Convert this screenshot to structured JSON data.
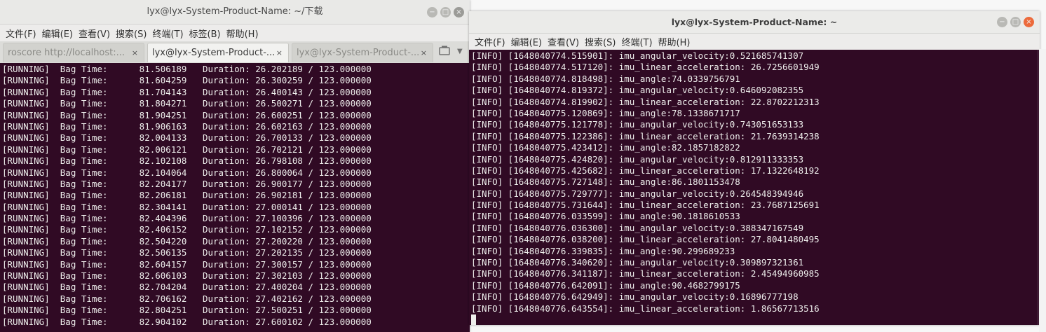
{
  "left_window": {
    "title": "lyx@lyx-System-Product-Name: ~/下载",
    "menu": [
      "文件(F)",
      "编辑(E)",
      "查看(V)",
      "搜索(S)",
      "终端(T)",
      "标签(B)",
      "帮助(H)"
    ],
    "tabs": [
      {
        "label": "roscore http://localhost:...",
        "close": "×"
      },
      {
        "label": "lyx@lyx-System-Product-...",
        "close": "×"
      },
      {
        "label": "lyx@lyx-System-Product-...",
        "close": "×"
      }
    ],
    "window_buttons": {
      "minimize": "−",
      "maximize": "□",
      "close": "×"
    },
    "lines": [
      "[RUNNING]  Bag Time:      81.506189   Duration: 26.202189 / 123.000000",
      "[RUNNING]  Bag Time:      81.604259   Duration: 26.300259 / 123.000000",
      "[RUNNING]  Bag Time:      81.704143   Duration: 26.400143 / 123.000000",
      "[RUNNING]  Bag Time:      81.804271   Duration: 26.500271 / 123.000000",
      "[RUNNING]  Bag Time:      81.904251   Duration: 26.600251 / 123.000000",
      "[RUNNING]  Bag Time:      81.906163   Duration: 26.602163 / 123.000000",
      "[RUNNING]  Bag Time:      82.004133   Duration: 26.700133 / 123.000000",
      "[RUNNING]  Bag Time:      82.006121   Duration: 26.702121 / 123.000000",
      "[RUNNING]  Bag Time:      82.102108   Duration: 26.798108 / 123.000000",
      "[RUNNING]  Bag Time:      82.104064   Duration: 26.800064 / 123.000000",
      "[RUNNING]  Bag Time:      82.204177   Duration: 26.900177 / 123.000000",
      "[RUNNING]  Bag Time:      82.206181   Duration: 26.902181 / 123.000000",
      "[RUNNING]  Bag Time:      82.304141   Duration: 27.000141 / 123.000000",
      "[RUNNING]  Bag Time:      82.404396   Duration: 27.100396 / 123.000000",
      "[RUNNING]  Bag Time:      82.406152   Duration: 27.102152 / 123.000000",
      "[RUNNING]  Bag Time:      82.504220   Duration: 27.200220 / 123.000000",
      "[RUNNING]  Bag Time:      82.506135   Duration: 27.202135 / 123.000000",
      "[RUNNING]  Bag Time:      82.604157   Duration: 27.300157 / 123.000000",
      "[RUNNING]  Bag Time:      82.606103   Duration: 27.302103 / 123.000000",
      "[RUNNING]  Bag Time:      82.704204   Duration: 27.400204 / 123.000000",
      "[RUNNING]  Bag Time:      82.706162   Duration: 27.402162 / 123.000000",
      "[RUNNING]  Bag Time:      82.804251   Duration: 27.500251 / 123.000000",
      "[RUNNING]  Bag Time:      82.904102   Duration: 27.600102 / 123.000000"
    ]
  },
  "right_window": {
    "title": "lyx@lyx-System-Product-Name: ~",
    "menu": [
      "文件(F)",
      "编辑(E)",
      "查看(V)",
      "搜索(S)",
      "终端(T)",
      "帮助(H)"
    ],
    "window_buttons": {
      "minimize": "−",
      "maximize": "□",
      "close": "×"
    },
    "lines": [
      "[INFO] [1648040774.515901]: imu_angular_velocity:0.521685741307",
      "[INFO] [1648040774.517120]: imu_linear_acceleration: 26.7256601949",
      "[INFO] [1648040774.818498]: imu_angle:74.0339756791",
      "[INFO] [1648040774.819372]: imu_angular_velocity:0.646092082355",
      "[INFO] [1648040774.819902]: imu_linear_acceleration: 22.8702212313",
      "[INFO] [1648040775.120869]: imu_angle:78.1338671717",
      "[INFO] [1648040775.121778]: imu_angular_velocity:0.743051653133",
      "[INFO] [1648040775.122386]: imu_linear_acceleration: 21.7639314238",
      "[INFO] [1648040775.423412]: imu_angle:82.1857182822",
      "[INFO] [1648040775.424820]: imu_angular_velocity:0.812911333353",
      "[INFO] [1648040775.425682]: imu_linear_acceleration: 17.1322648192",
      "[INFO] [1648040775.727148]: imu_angle:86.1801153478",
      "[INFO] [1648040775.729777]: imu_angular_velocity:0.264548394946",
      "[INFO] [1648040775.731644]: imu_linear_acceleration: 23.7687125691",
      "[INFO] [1648040776.033599]: imu_angle:90.1818610533",
      "[INFO] [1648040776.036300]: imu_angular_velocity:0.388347167549",
      "[INFO] [1648040776.038200]: imu_linear_acceleration: 27.8041480495",
      "[INFO] [1648040776.339835]: imu_angle:90.299689233",
      "[INFO] [1648040776.340620]: imu_angular_velocity:0.309897321361",
      "[INFO] [1648040776.341187]: imu_linear_acceleration: 2.45494960985",
      "[INFO] [1648040776.642091]: imu_angle:90.4682799175",
      "[INFO] [1648040776.642949]: imu_angular_velocity:0.16896777198",
      "[INFO] [1648040776.643554]: imu_linear_acceleration: 1.86567713516"
    ]
  },
  "colors": {
    "terminal_bg": "#300a24",
    "terminal_fg": "#eeeeec",
    "close_button_active": "#ec6a3b"
  }
}
